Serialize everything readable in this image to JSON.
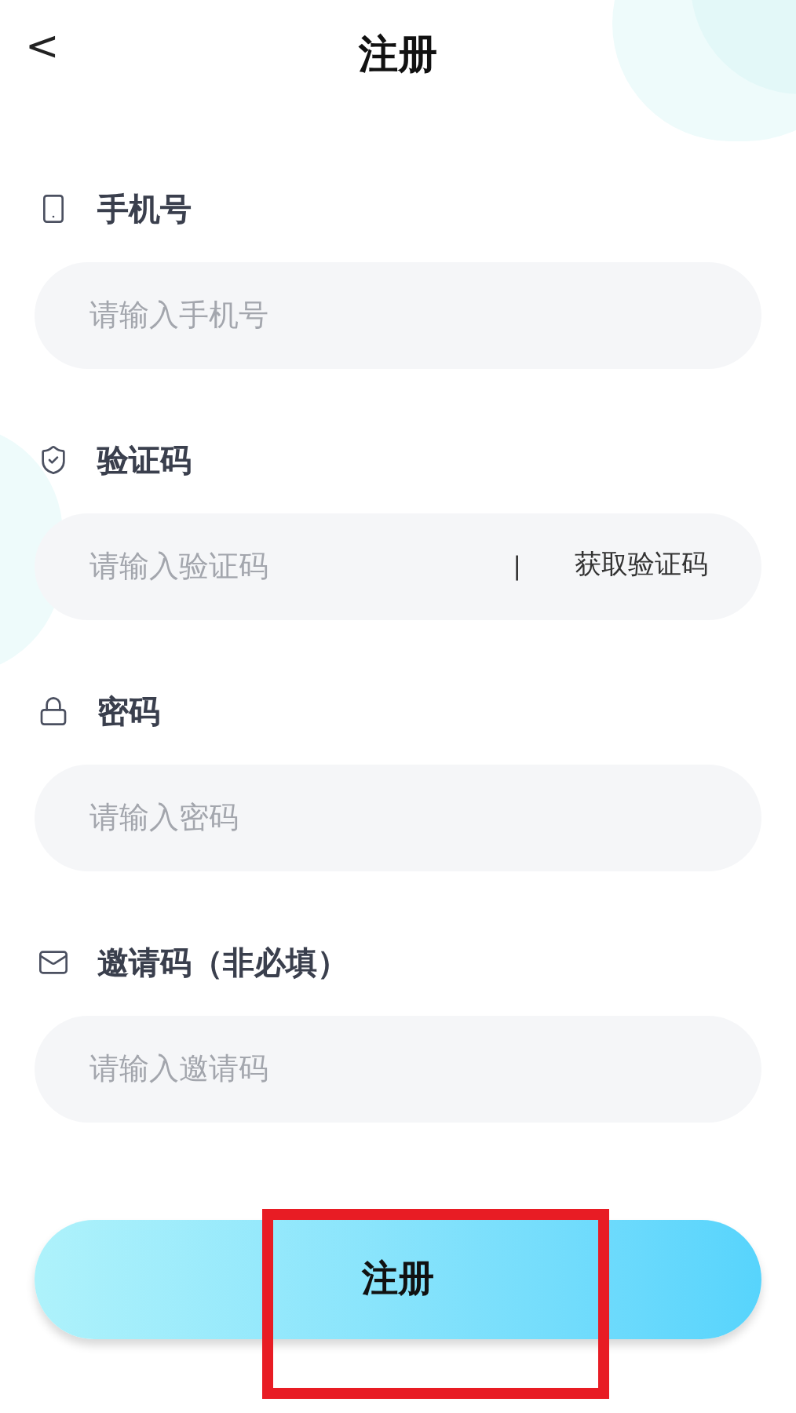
{
  "header": {
    "back": "<",
    "title": "注册"
  },
  "fields": [
    {
      "kind": "phone",
      "label": "手机号",
      "placeholder": "请输入手机号"
    },
    {
      "kind": "code",
      "label": "验证码",
      "placeholder": "请输入验证码",
      "separator": "|",
      "action": "获取验证码"
    },
    {
      "kind": "password",
      "label": "密码",
      "placeholder": "请输入密码"
    },
    {
      "kind": "invite",
      "label": "邀请码（非必填）",
      "placeholder": "请输入邀请码"
    }
  ],
  "submit": {
    "label": "注册"
  },
  "annotation": {
    "kind": "highlight"
  }
}
